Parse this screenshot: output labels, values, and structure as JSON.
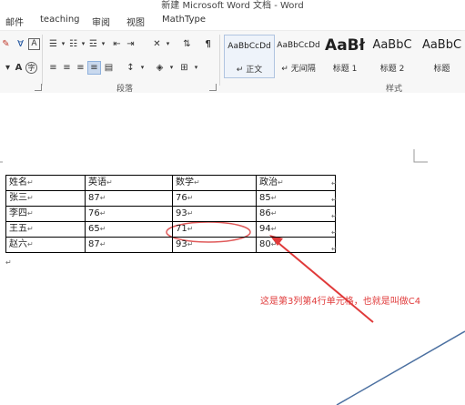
{
  "window": {
    "title": "新建 Microsoft Word 文档 - Word"
  },
  "tabs": [
    "邮件",
    "teaching",
    "审阅",
    "视图",
    "MathType"
  ],
  "ribbon": {
    "groups": {
      "paragraph": "段落",
      "styles": "样式"
    },
    "styles": [
      {
        "preview": "AaBbCcDd",
        "name": "↵ 正文"
      },
      {
        "preview": "AaBbCcDd",
        "name": "↵ 无间隔"
      },
      {
        "preview": "AaBł",
        "name": "标题 1"
      },
      {
        "preview": "AaBbC",
        "name": "标题 2"
      },
      {
        "preview": "AaBbC",
        "name": "标题"
      }
    ]
  },
  "table": {
    "headers": [
      "姓名",
      "英语",
      "数学",
      "政治"
    ],
    "rows": [
      [
        "张三",
        "87",
        "76",
        "85"
      ],
      [
        "李四",
        "76",
        "93",
        "86"
      ],
      [
        "王五",
        "65",
        "71",
        "94"
      ],
      [
        "赵六",
        "87",
        "93",
        "80"
      ]
    ],
    "mark": "↵"
  },
  "annotation": {
    "text": "这是第3列第4行单元格，也就是叫做C4"
  },
  "colors": {
    "annotation": "#e03a3a",
    "ribbon_bg": "#f7f7f7"
  }
}
